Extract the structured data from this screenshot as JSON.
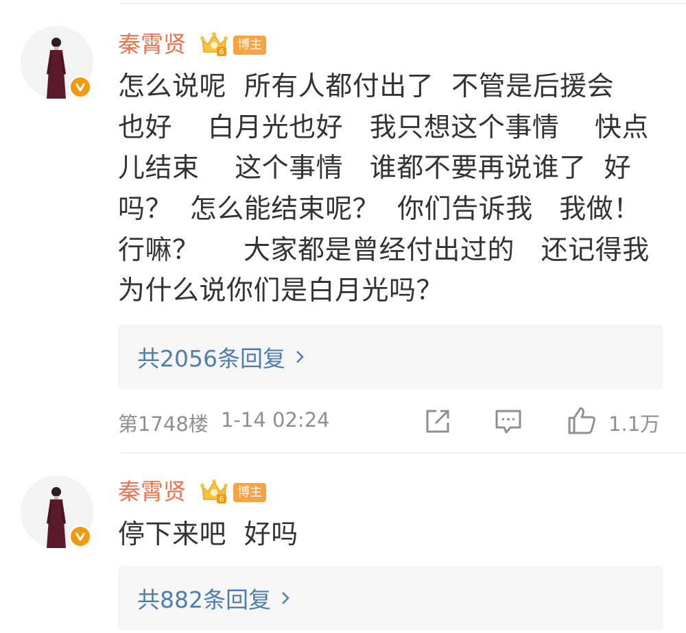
{
  "comments": [
    {
      "username": "秦霄贤",
      "tag": "博主",
      "lines": [
        "怎么说呢  所有人都付出了  不管是后援会",
        "也好    白月光也好   我只想这个事情    快点",
        "儿结束    这个事情   谁都不要再说谁了  好",
        "吗？  怎么能结束呢？  你们告诉我   我做！",
        "行嘛？     大家都是曾经付出过的   还记得我",
        "为什么说你们是白月光吗？"
      ],
      "reply_text": "共2056条回复",
      "floor": "第1748楼",
      "time": "1-14 02:24",
      "likes": "1.1万"
    },
    {
      "username": "秦霄贤",
      "tag": "博主",
      "lines": [
        "停下来吧  好吗"
      ],
      "reply_text": "共882条回复"
    }
  ],
  "colors": {
    "username": "#eb7350",
    "tag_bg": "#f6a345",
    "verified_badge": "#f39a0b",
    "link": "#507daf",
    "meta": "#8f8f8f",
    "body_text": "#333333"
  },
  "icons": [
    "crown-level-icon",
    "verified-v-icon",
    "chevron-right-icon",
    "forward-icon",
    "comment-icon",
    "like-icon"
  ]
}
